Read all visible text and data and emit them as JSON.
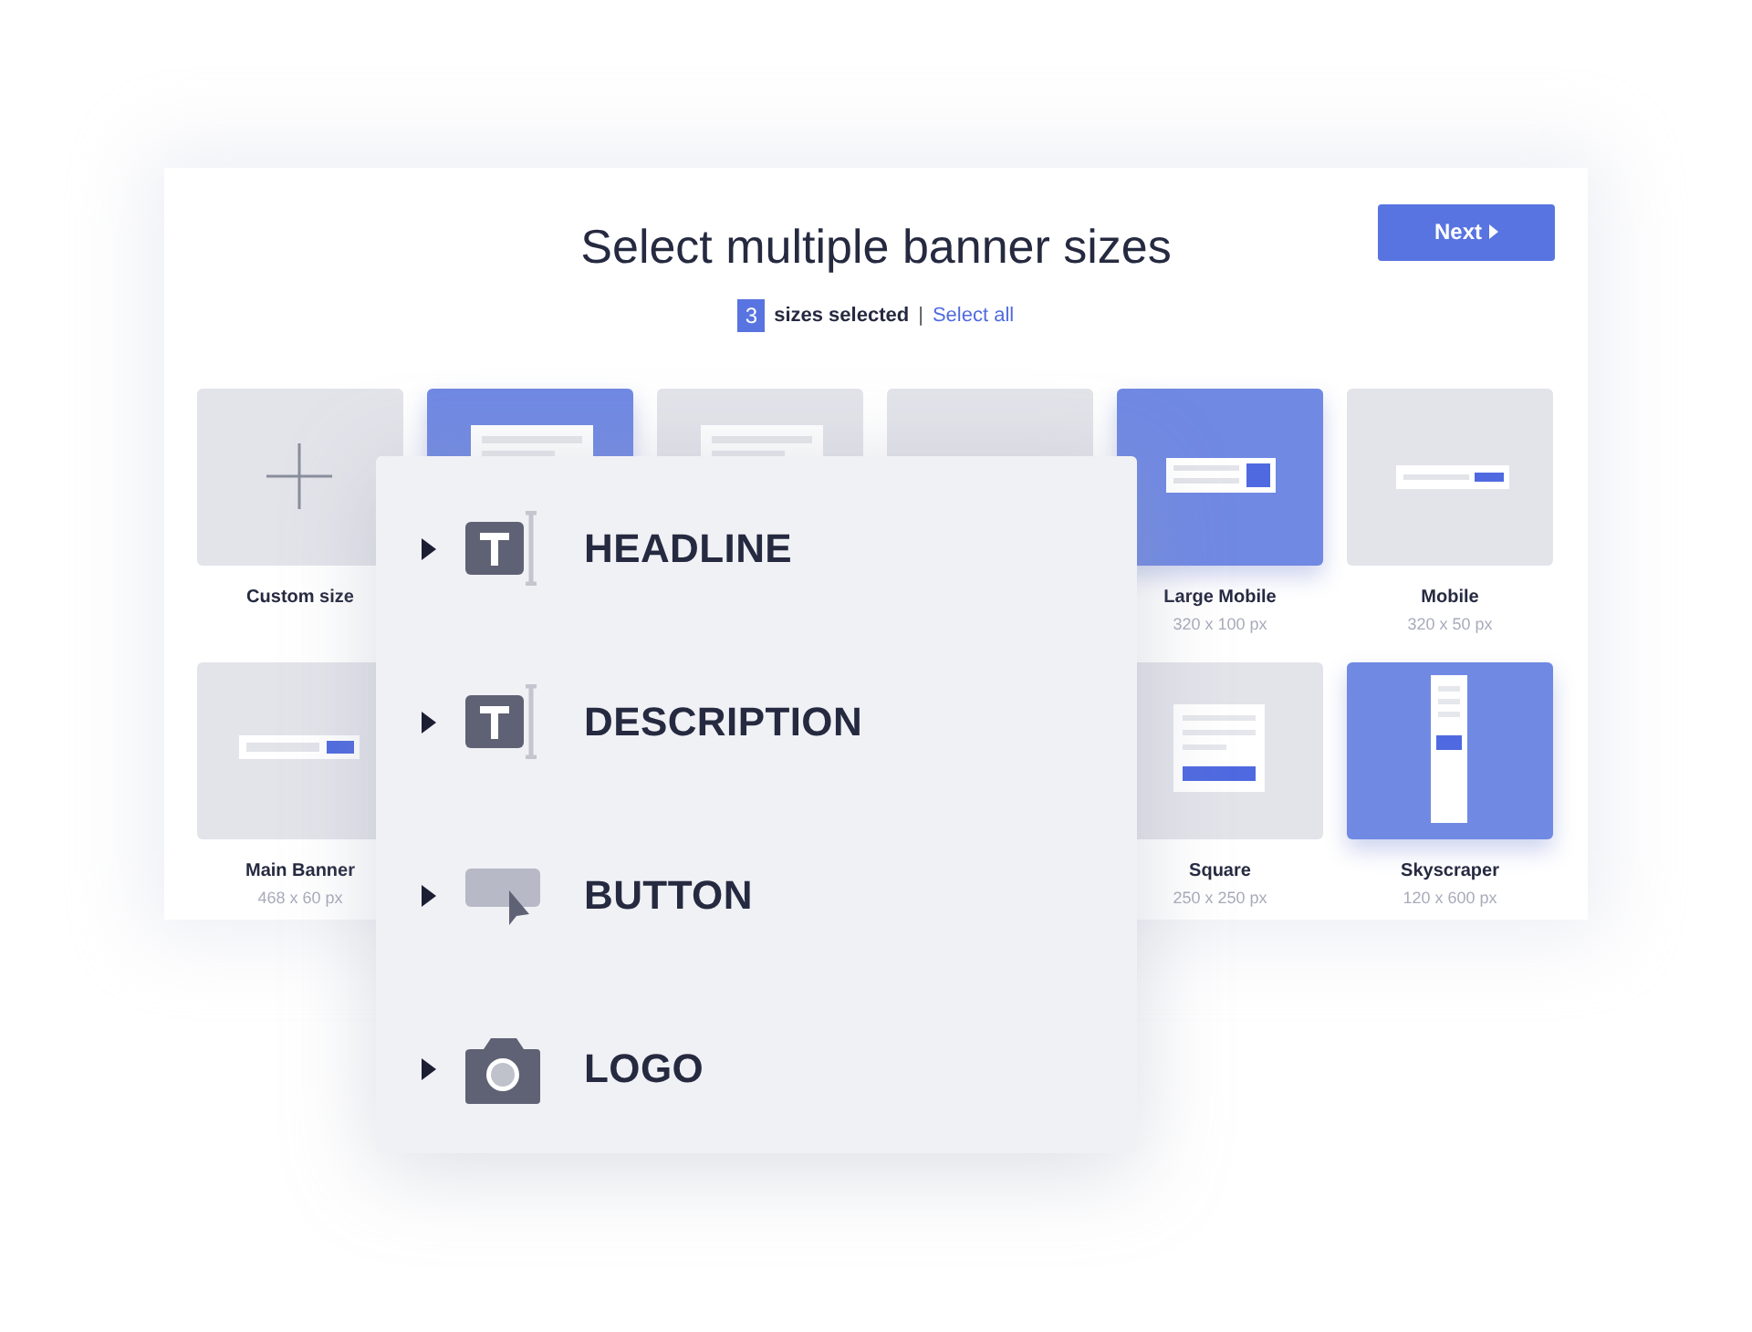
{
  "header": {
    "title": "Select multiple banner sizes",
    "next_button": "Next",
    "selected_count": "3",
    "selected_label": "sizes selected",
    "separator": "|",
    "select_all_link": "Select all"
  },
  "cards_row_1": [
    {
      "kind": "custom",
      "selected": false,
      "name": "Custom size"
    },
    {
      "kind": "page",
      "selected": true
    },
    {
      "kind": "page",
      "selected": false
    },
    {
      "kind": "blank",
      "selected": false
    },
    {
      "kind": "large-mobile",
      "selected": true,
      "name": "Large Mobile",
      "size": "320 x 100 px"
    },
    {
      "kind": "mobile",
      "selected": false,
      "name": "Mobile",
      "size": "320 x 50 px"
    }
  ],
  "cards_row_2": [
    {
      "kind": "leaderboard",
      "selected": false,
      "name": "Main Banner",
      "size": "468 x 60 px"
    },
    {
      "kind": "square",
      "selected": false,
      "name": "Square",
      "size": "250 x 250 px"
    },
    {
      "kind": "skyscraper",
      "selected": true,
      "name": "Skyscraper",
      "size": "120 x 600 px"
    }
  ],
  "elements_panel": [
    {
      "kind": "text",
      "label": "HEADLINE",
      "expanded": false
    },
    {
      "kind": "text",
      "label": "DESCRIPTION",
      "expanded": false
    },
    {
      "kind": "button",
      "label": "BUTTON",
      "expanded": false
    },
    {
      "kind": "image",
      "label": "LOGO",
      "expanded": false
    }
  ]
}
